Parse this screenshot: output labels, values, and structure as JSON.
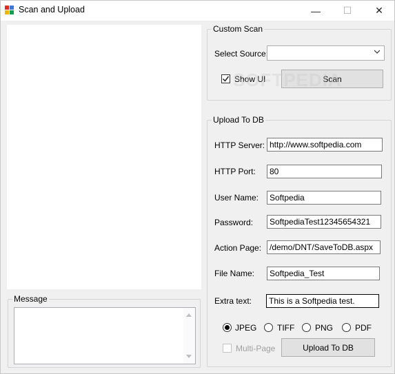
{
  "window": {
    "title": "Scan and Upload",
    "controls": {
      "minimize": "—",
      "maximize": "☐",
      "close": "✕"
    }
  },
  "message_group": {
    "title": "Message",
    "text": ""
  },
  "custom_scan": {
    "title": "Custom Scan",
    "select_source_label": "Select Source:",
    "select_source_value": "",
    "show_ui_label": "Show UI",
    "show_ui_checked": true,
    "scan_button": "Scan"
  },
  "upload_to_db": {
    "title": "Upload To DB",
    "fields": [
      {
        "label": "HTTP Server:",
        "value": "http://www.softpedia.com"
      },
      {
        "label": "HTTP Port:",
        "value": "80"
      },
      {
        "label": "User Name:",
        "value": "Softpedia"
      },
      {
        "label": "Password:",
        "value": "SoftpediaTest12345654321"
      },
      {
        "label": "Action Page:",
        "value": "/demo/DNT/SaveToDB.aspx"
      },
      {
        "label": "File Name:",
        "value": "Softpedia_Test"
      },
      {
        "label": "Extra text:",
        "value": "This is a Softpedia test."
      }
    ],
    "formats": [
      {
        "label": "JPEG",
        "selected": true
      },
      {
        "label": "TIFF",
        "selected": false
      },
      {
        "label": "PNG",
        "selected": false
      },
      {
        "label": "PDF",
        "selected": false
      }
    ],
    "multi_page_label": "Multi-Page",
    "multi_page_enabled": false,
    "upload_button": "Upload To DB"
  },
  "watermark": "SOFTPEDIA",
  "colors": {
    "window_bg": "#f0f0f0",
    "button_bg": "#e1e1e1",
    "border": "#adadad"
  }
}
